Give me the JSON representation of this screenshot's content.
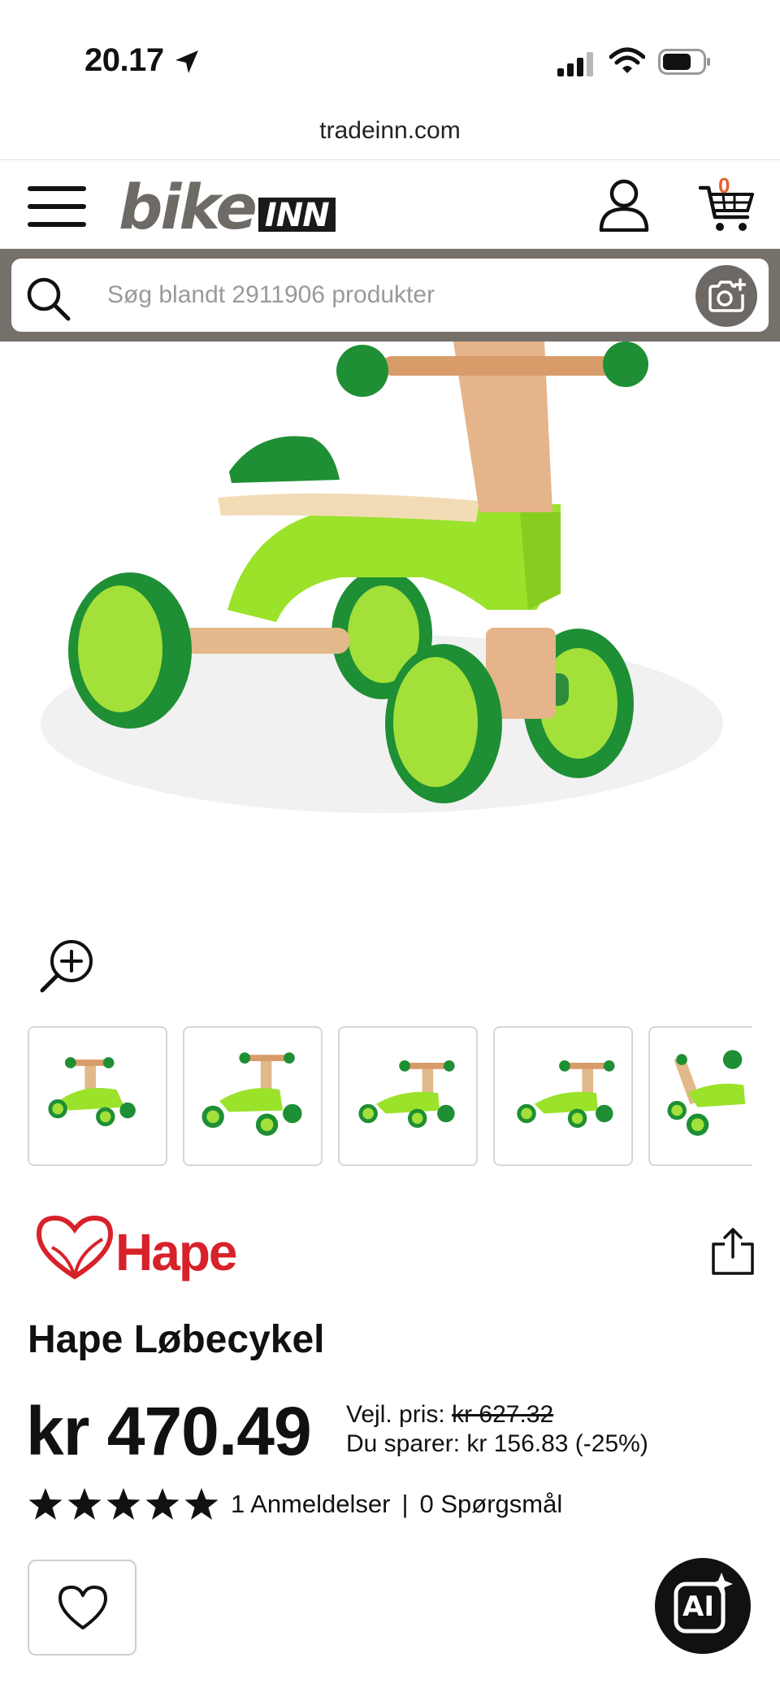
{
  "status_bar": {
    "time": "20.17",
    "icons": [
      "location-arrow-icon",
      "signal-icon",
      "wifi-icon",
      "battery-icon"
    ]
  },
  "browser": {
    "url": "tradeinn.com"
  },
  "header": {
    "logo_bike": "bike",
    "logo_inn": "INN",
    "cart_count": "0",
    "icons": [
      "menu-icon",
      "user-icon",
      "cart-icon"
    ]
  },
  "search": {
    "placeholder": "Søg blandt 2911906 produkter",
    "value": ""
  },
  "product": {
    "brand": "Hape",
    "title": "Hape Løbecykel",
    "price": "kr 470.49",
    "rrp_label": "Vejl. pris:",
    "rrp_value": "kr 627.32",
    "savings": "Du sparer: kr 156.83 (-25%)",
    "rating_stars": 5,
    "reviews": "1 Anmeldelser",
    "separator": "|",
    "questions": "0 Spørgsmål"
  },
  "thumbnails_count": 5,
  "ai_button": {
    "label": "AI"
  },
  "colors": {
    "accent": "#e8612c",
    "search_bar_bg": "#76706a",
    "brand_red": "#d7222a",
    "product_green": "#9be22b",
    "wheel_green": "#1f9a38"
  }
}
